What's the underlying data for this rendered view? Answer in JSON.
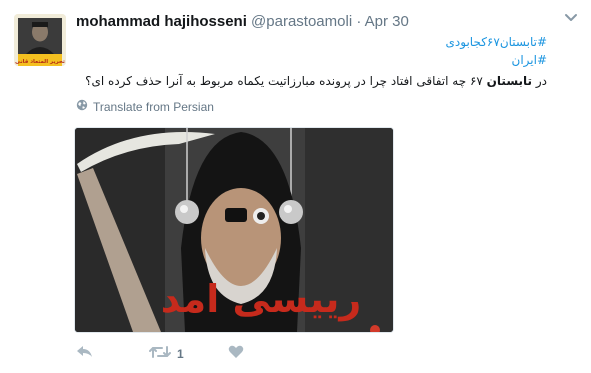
{
  "tweet": {
    "author_name": "mohammad hajihosseni",
    "author_handle": "@parastoamoli",
    "separator": "·",
    "timestamp": "Apr 30",
    "avatar_caption": "تحریر المتعاد قانی",
    "hashtags": [
      "#تابستان۶۷کجابودی",
      "#ایران"
    ],
    "text_before": "در ",
    "text_bold": "تابستان",
    "text_after": " ۶۷ چه اتفاقی افتاد چرا در پرونده مبارزاتیت یکماه مربوط به آنرا حذف کرده ای؟",
    "translate_label": "Translate from Persian",
    "image_caption": "رییسی امد",
    "retweet_count": "1",
    "colors": {
      "accent": "#1b95e0",
      "muted": "#657786",
      "caption_red": "#c62a1c"
    }
  }
}
